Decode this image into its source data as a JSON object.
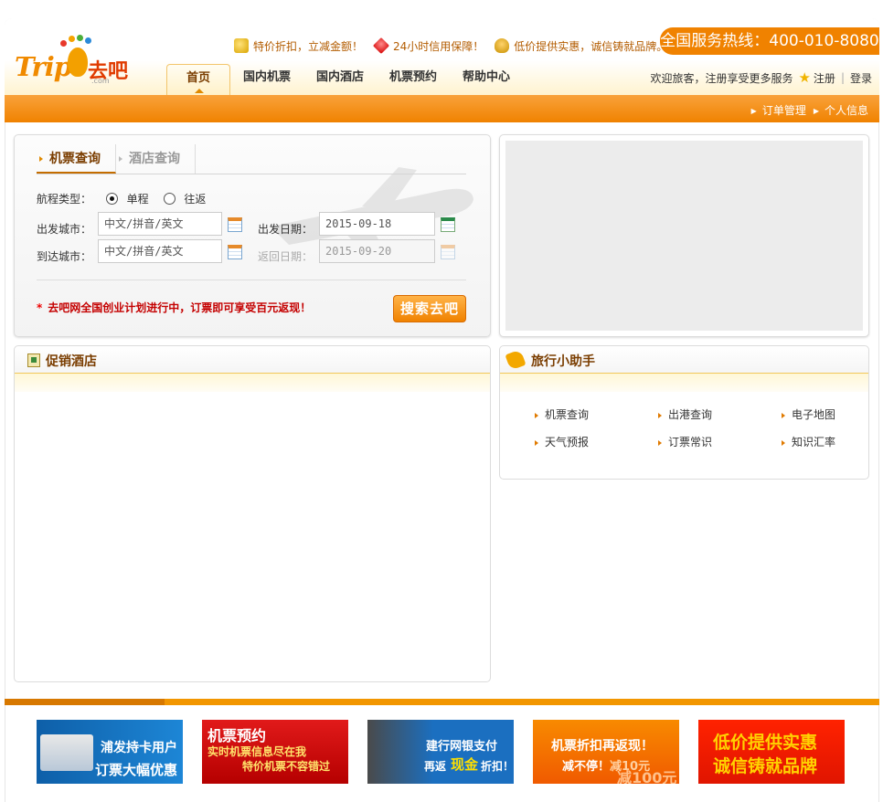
{
  "header": {
    "logo": {
      "en": "Trip",
      "cn": "去吧",
      "sub": ".com"
    },
    "promos": [
      {
        "icon": "coins-icon",
        "text": "特价折扣，立减金额！"
      },
      {
        "icon": "gem-icon",
        "text": "24小时信用保障！"
      },
      {
        "icon": "medal-icon",
        "text": "低价提供实惠，诚信铸就品牌。"
      }
    ],
    "hotline": "全国服务热线：400-010-8080",
    "nav": [
      "首页",
      "国内机票",
      "国内酒店",
      "机票预约",
      "帮助中心"
    ],
    "welcome": "欢迎旅客，注册享受更多服务",
    "register": "注册",
    "separator": "|",
    "login": "登录",
    "subnav": [
      "订单管理",
      "个人信息"
    ]
  },
  "search": {
    "tabs": [
      "机票查询",
      "酒店查询"
    ],
    "trip_type_label": "航程类型：",
    "trip_types": [
      "单程",
      "往返"
    ],
    "selected_trip_type": "单程",
    "from_label": "出发城市：",
    "to_label": "到达城市：",
    "from_placeholder": "中文/拼音/英文",
    "to_placeholder": "中文/拼音/英文",
    "depart_label": "出发日期：",
    "return_label": "返回日期：",
    "depart_date": "2015-09-18",
    "return_date": "2015-09-20",
    "notice_mark": "*",
    "notice": "去吧网全国创业计划进行中，订票即可享受百元返现！",
    "search_button": "搜索去吧"
  },
  "hotels": {
    "title": "促销酒店"
  },
  "helper": {
    "title": "旅行小助手",
    "items": [
      "机票查询",
      "出港查询",
      "电子地图",
      "天气预报",
      "订票常识",
      "知识汇率"
    ]
  },
  "ads": [
    {
      "lines": [
        "浦发持卡用户",
        "订票大幅优惠"
      ]
    },
    {
      "lines": [
        "机票预约",
        "实时机票信息尽在我",
        "特价机票不容错过"
      ]
    },
    {
      "lines": [
        "建行网银支付",
        "再返",
        "现金",
        "折扣！"
      ]
    },
    {
      "lines": [
        "机票折扣再返现！",
        "减不停！",
        "减10元",
        "减100元"
      ]
    },
    {
      "lines": [
        "低价提供实惠",
        "诚信铸就品牌"
      ]
    }
  ],
  "colors": {
    "accent": "#f08200",
    "title_brown": "#7a3d00",
    "notice_red": "#c40000"
  }
}
